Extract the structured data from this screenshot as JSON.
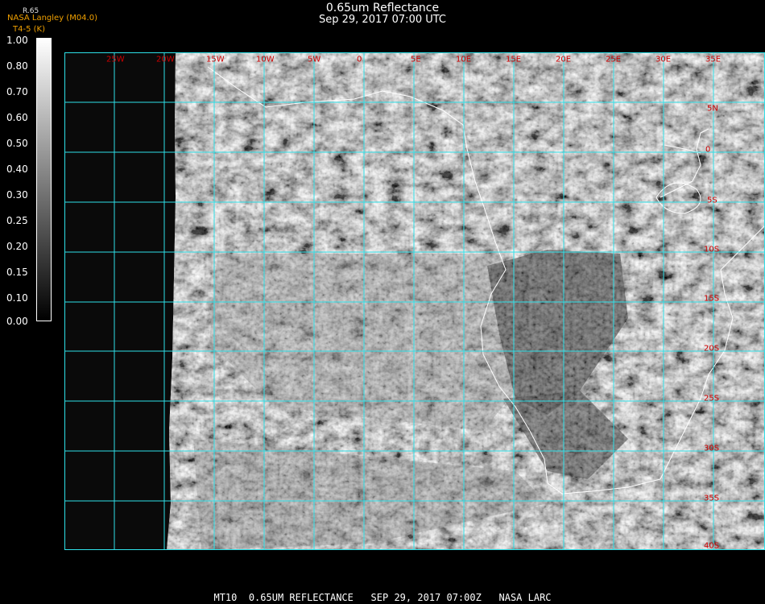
{
  "header": {
    "title": "0.65um Reflectance",
    "subtitle": "Sep 29, 2017 07:00 UTC"
  },
  "credit": {
    "top": "R.65",
    "line1": "NASA Langley (M04.0)",
    "line2": "T4-5 (K)"
  },
  "colorbar": {
    "labels": [
      "1.00",
      "0.80",
      "0.70",
      "0.60",
      "0.50",
      "0.40",
      "0.30",
      "0.25",
      "0.20",
      "0.15",
      "0.10",
      "0.00"
    ]
  },
  "map": {
    "longitude_labels": [
      "25W",
      "20W",
      "15W",
      "10W",
      "5W",
      "0",
      "5E",
      "10E",
      "15E",
      "20E",
      "25E",
      "30E",
      "35E"
    ],
    "latitude_labels": [
      "5N",
      "0",
      "5S",
      "10S",
      "15S",
      "20S",
      "25S",
      "30S",
      "35S",
      "40S"
    ],
    "grid_color": "#2fe0e8",
    "label_color": "#d00000"
  },
  "footer": {
    "text": "MT10  0.65UM REFLECTANCE   SEP 29, 2017 07:00Z   NASA LARC"
  }
}
